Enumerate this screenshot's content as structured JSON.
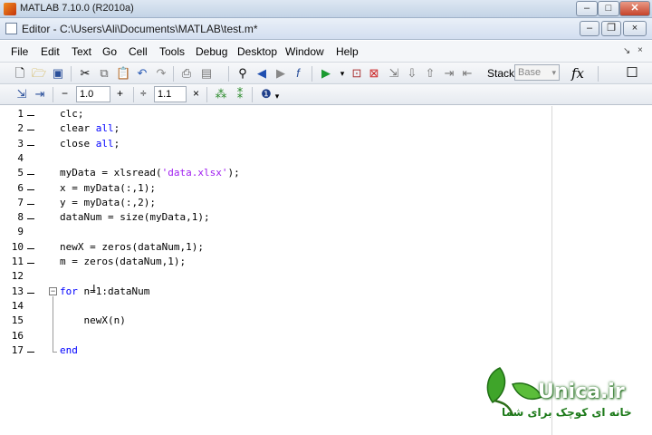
{
  "app_title": "MATLAB  7.10.0 (R2010a)",
  "window_controls": {
    "minimize": "–",
    "maximize": "□",
    "close": "✕"
  },
  "editor_title": "Editor - C:\\Users\\Ali\\Documents\\MATLAB\\test.m*",
  "editor_controls": {
    "minimize": "–",
    "restore": "❐",
    "close": "×"
  },
  "menu": [
    "File",
    "Edit",
    "Text",
    "Go",
    "Cell",
    "Tools",
    "Debug",
    "Desktop",
    "Window",
    "Help"
  ],
  "toolbar": {
    "stack_label": "Stack:",
    "stack_value": "Base",
    "fx_label": "fx"
  },
  "cellbar": {
    "minus": "−",
    "decrement_value": "1.0",
    "plus": "+",
    "divide": "÷",
    "multiplier_value": "1.1",
    "times": "×"
  },
  "code_lines": [
    {
      "n": "1",
      "text": "clc;",
      "exec": true
    },
    {
      "n": "2",
      "text": "clear all;",
      "exec": true
    },
    {
      "n": "3",
      "text": "close all;",
      "exec": true
    },
    {
      "n": "4",
      "text": "",
      "exec": false
    },
    {
      "n": "5",
      "text": "myData = xlsread('data.xlsx');",
      "exec": true
    },
    {
      "n": "6",
      "text": "x = myData(:,1);",
      "exec": true
    },
    {
      "n": "7",
      "text": "y = myData(:,2);",
      "exec": true
    },
    {
      "n": "8",
      "text": "dataNum = size(myData,1);",
      "exec": true
    },
    {
      "n": "9",
      "text": "",
      "exec": false
    },
    {
      "n": "10",
      "text": "newX = zeros(dataNum,1);",
      "exec": true
    },
    {
      "n": "11",
      "text": "m = zeros(dataNum,1);",
      "exec": true
    },
    {
      "n": "12",
      "text": "",
      "exec": false
    },
    {
      "n": "13",
      "text": "for n=1:dataNum",
      "exec": true
    },
    {
      "n": "14",
      "text": "",
      "exec": false
    },
    {
      "n": "15",
      "text": "    newX(n)",
      "exec": false
    },
    {
      "n": "16",
      "text": "",
      "exec": false
    },
    {
      "n": "17",
      "text": "end",
      "exec": true
    }
  ],
  "watermark": {
    "brand": "Unica.ir",
    "tagline": "خانه ای کوچک برای شما"
  },
  "colors": {
    "keyword": "#0000ff",
    "string": "#a020f0"
  }
}
